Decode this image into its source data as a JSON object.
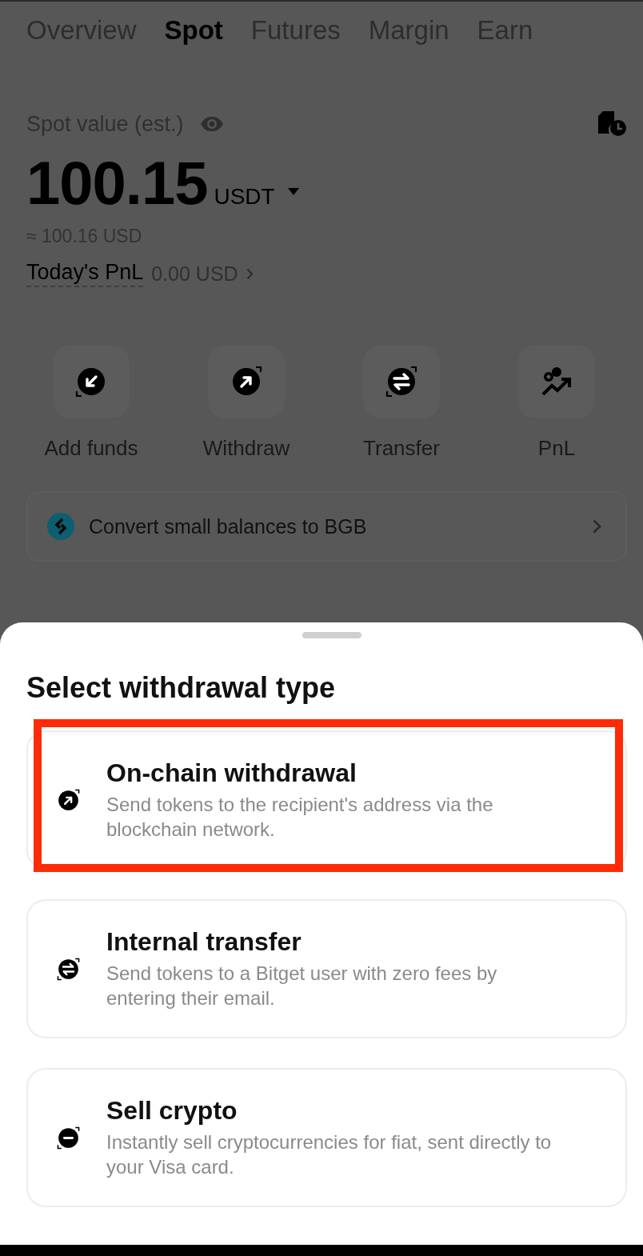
{
  "tabs": [
    {
      "label": "Overview",
      "selected": false
    },
    {
      "label": "Spot",
      "selected": true
    },
    {
      "label": "Futures",
      "selected": false
    },
    {
      "label": "Margin",
      "selected": false
    },
    {
      "label": "Earn",
      "selected": false
    }
  ],
  "balance": {
    "label": "Spot value (est.)",
    "amount": "100.15",
    "currency": "USDT",
    "approx": "≈ 100.16 USD",
    "pnl_label": "Today's PnL",
    "pnl_value": "0.00 USD"
  },
  "actions": [
    {
      "kind": "deposit",
      "label": "Add funds"
    },
    {
      "kind": "withdraw",
      "label": "Withdraw"
    },
    {
      "kind": "transfer",
      "label": "Transfer"
    },
    {
      "kind": "pnl",
      "label": "PnL"
    }
  ],
  "convert_banner": {
    "text": "Convert small balances to BGB"
  },
  "sheet": {
    "title": "Select withdrawal type",
    "options": [
      {
        "kind": "withdraw",
        "title": "On-chain withdrawal",
        "description": "Send tokens to the recipient's address via the blockchain network.",
        "highlighted": true
      },
      {
        "kind": "transfer",
        "title": "Internal transfer",
        "description": "Send tokens to a Bitget user with zero fees by entering their email.",
        "highlighted": false
      },
      {
        "kind": "sell",
        "title": "Sell crypto",
        "description": "Instantly sell cryptocurrencies for fiat, sent directly to your Visa card.",
        "highlighted": false
      }
    ]
  }
}
